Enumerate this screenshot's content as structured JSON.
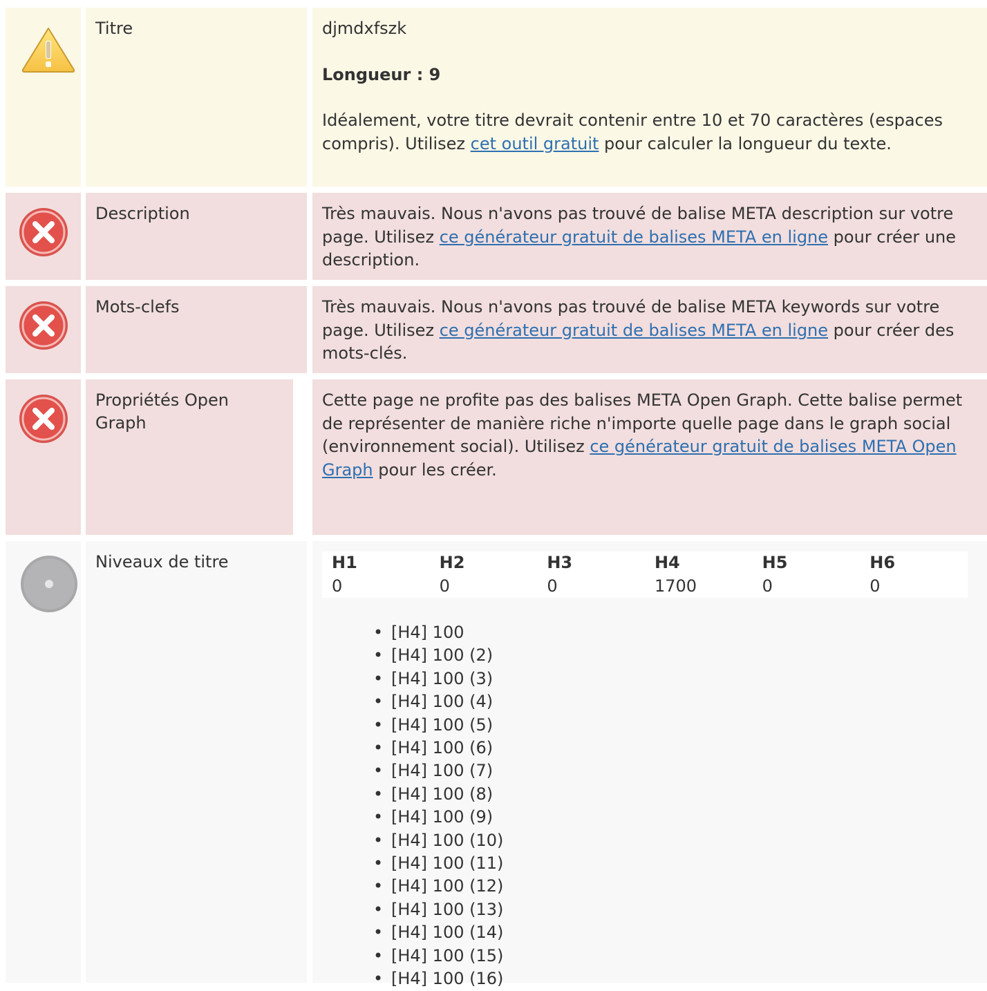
{
  "rows": {
    "title": {
      "label": "Titre",
      "value": "djmdxfszk",
      "length_text": "Longueur : 9",
      "advice_before": "Idéalement, votre titre devrait contenir entre 10 et 70 caractères (espaces compris). Utilisez ",
      "link": "cet outil gratuit",
      "advice_after": " pour calculer la longueur du texte.",
      "status_icon": "warning-icon"
    },
    "description": {
      "label": "Description",
      "text_before": "Très mauvais. Nous n'avons pas trouvé de balise META description sur votre page. Utilisez ",
      "link": "ce générateur gratuit de balises META en ligne",
      "text_after": " pour créer une description.",
      "status_icon": "error-icon"
    },
    "keywords": {
      "label": "Mots-clefs",
      "text_before": "Très mauvais. Nous n'avons pas trouvé de balise META keywords sur votre page. Utilisez ",
      "link": "ce générateur gratuit de balises META en ligne",
      "text_after": " pour créer des mots-clés.",
      "status_icon": "error-icon"
    },
    "open_graph": {
      "label": "Propriétés Open Graph",
      "text_before": "Cette page ne profite pas des balises META Open Graph. Cette balise permet de représenter de manière riche n'importe quelle page dans le graph social (environnement social). Utilisez ",
      "link": "ce générateur gratuit de balises META Open Graph",
      "text_after": " pour les créer.",
      "status_icon": "error-icon"
    },
    "headings": {
      "label": "Niveaux de titre",
      "status_icon": "info-disc-icon",
      "table": {
        "headers": [
          "H1",
          "H2",
          "H3",
          "H4",
          "H5",
          "H6"
        ],
        "values": [
          "0",
          "0",
          "0",
          "1700",
          "0",
          "0"
        ]
      },
      "items": [
        "[H4] 100",
        "[H4] 100 (2)",
        "[H4] 100 (3)",
        "[H4] 100 (4)",
        "[H4] 100 (5)",
        "[H4] 100 (6)",
        "[H4] 100 (7)",
        "[H4] 100 (8)",
        "[H4] 100 (9)",
        "[H4] 100 (10)",
        "[H4] 100 (11)",
        "[H4] 100 (12)",
        "[H4] 100 (13)",
        "[H4] 100 (14)",
        "[H4] 100 (15)",
        "[H4] 100 (16)"
      ]
    }
  },
  "colors": {
    "warning_bg": "#fbf8e6",
    "error_bg": "#f2dede",
    "info_bg": "#f8f8f8",
    "link": "#2e6fb0",
    "error_icon": "#d9534f",
    "info_icon": "#a8a8aa"
  }
}
